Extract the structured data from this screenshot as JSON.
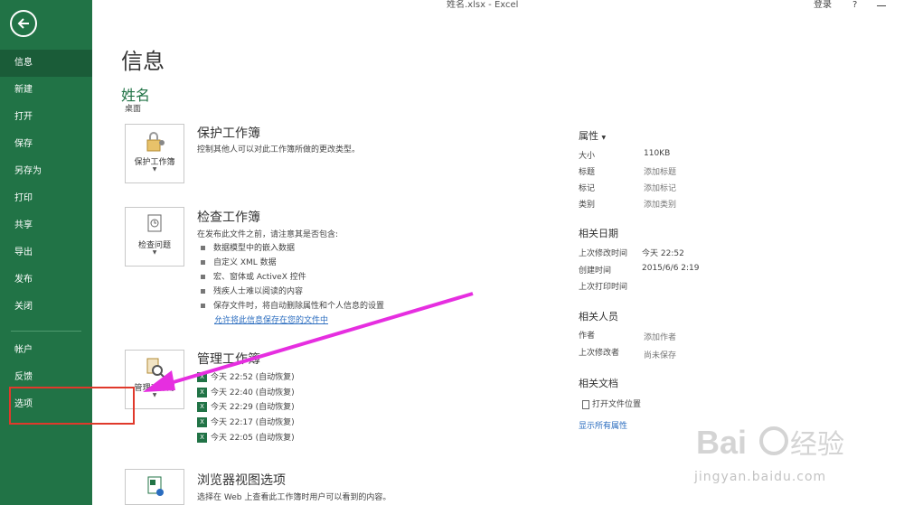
{
  "window": {
    "title": "姓名.xlsx - Excel",
    "login": "登录",
    "help": "?"
  },
  "sidebar": {
    "items": [
      {
        "label": "信息",
        "active": true
      },
      {
        "label": "新建"
      },
      {
        "label": "打开"
      },
      {
        "label": "保存"
      },
      {
        "label": "另存为"
      },
      {
        "label": "打印"
      },
      {
        "label": "共享"
      },
      {
        "label": "导出"
      },
      {
        "label": "发布"
      },
      {
        "label": "关闭"
      },
      {
        "label": "帐户"
      },
      {
        "label": "反馈"
      },
      {
        "label": "选项"
      }
    ]
  },
  "main": {
    "title": "信息",
    "file_name": "姓名",
    "file_location": "桌面",
    "protect": {
      "tile_label": "保护工作簿",
      "title": "保护工作簿",
      "desc": "控制其他人可以对此工作簿所做的更改类型。"
    },
    "inspect": {
      "tile_label": "检查问题",
      "title": "检查工作簿",
      "desc": "在发布此文件之前，请注意其是否包含:",
      "bullets": [
        "数据模型中的嵌入数据",
        "自定义 XML 数据",
        "宏、窗体或 ActiveX 控件",
        "残疾人士难以阅读的内容",
        "保存文件时，将自动删除属性和个人信息的设置"
      ],
      "link": "允许将此信息保存在您的文件中"
    },
    "manage": {
      "tile_label": "管理工作簿",
      "title": "管理工作簿",
      "versions": [
        "今天 22:52 (自动恢复)",
        "今天 22:40 (自动恢复)",
        "今天 22:29 (自动恢复)",
        "今天 22:17 (自动恢复)",
        "今天 22:05 (自动恢复)"
      ]
    },
    "browser": {
      "title": "浏览器视图选项",
      "desc": "选择在 Web 上查看此工作簿时用户可以看到的内容。"
    }
  },
  "properties": {
    "header": "属性",
    "rows": [
      {
        "label": "大小",
        "value": "110KB"
      },
      {
        "label": "标题",
        "value": "添加标题"
      },
      {
        "label": "标记",
        "value": "添加标记"
      },
      {
        "label": "类别",
        "value": "添加类别"
      }
    ],
    "dates_header": "相关日期",
    "dates": [
      {
        "label": "上次修改时间",
        "value": "今天 22:52"
      },
      {
        "label": "创建时间",
        "value": "2015/6/6 2:19"
      },
      {
        "label": "上次打印时间",
        "value": ""
      }
    ],
    "people_header": "相关人员",
    "people": [
      {
        "label": "作者",
        "value": "添加作者"
      },
      {
        "label": "上次修改者",
        "value": "尚未保存"
      }
    ],
    "docs_header": "相关文档",
    "open_location": "打开文件位置",
    "show_all": "显示所有属性"
  },
  "watermark": {
    "text": "jingyan.baidu.com"
  },
  "colors": {
    "accent": "#217346",
    "annotation": "#e0392b",
    "arrow": "#e62ee0"
  }
}
